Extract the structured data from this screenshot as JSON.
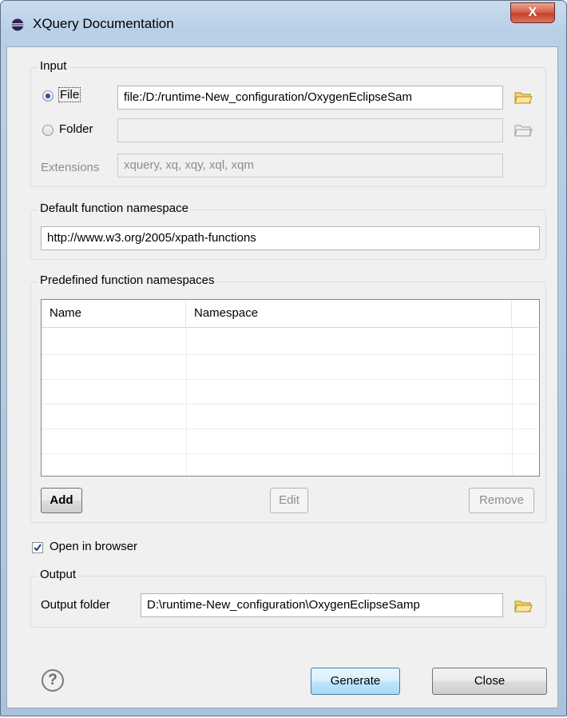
{
  "window": {
    "title": "XQuery Documentation",
    "close_symbol": "X",
    "icon": "eclipse-icon"
  },
  "input_group": {
    "label": "Input",
    "file_radio": {
      "label": "File",
      "checked": true,
      "value": "file:/D:/runtime-New_configuration/OxygenEclipseSam"
    },
    "folder_radio": {
      "label": "Folder",
      "checked": false,
      "value": ""
    },
    "extensions": {
      "label": "Extensions",
      "value": "xquery, xq, xqy, xql, xqm",
      "enabled": false
    }
  },
  "default_ns_group": {
    "label": "Default function namespace",
    "value": "http://www.w3.org/2005/xpath-functions"
  },
  "predefined_ns_group": {
    "label": "Predefined function namespaces",
    "columns": [
      "Name",
      "Namespace"
    ],
    "rows": [],
    "add_label": "Add",
    "edit_label": "Edit",
    "remove_label": "Remove"
  },
  "open_in_browser": {
    "label": "Open in browser",
    "checked": true
  },
  "output_group": {
    "label": "Output",
    "folder_label": "Output folder",
    "folder_value": "D:\\runtime-New_configuration\\OxygenEclipseSamp"
  },
  "footer": {
    "help_symbol": "?",
    "generate_label": "Generate",
    "close_label": "Close"
  },
  "colors": {
    "title_gradient": "#b9cfe6",
    "dialog_bg": "#f0f0f0",
    "close_red": "#c7402a",
    "default_button_blue": "#3c7fb1"
  }
}
